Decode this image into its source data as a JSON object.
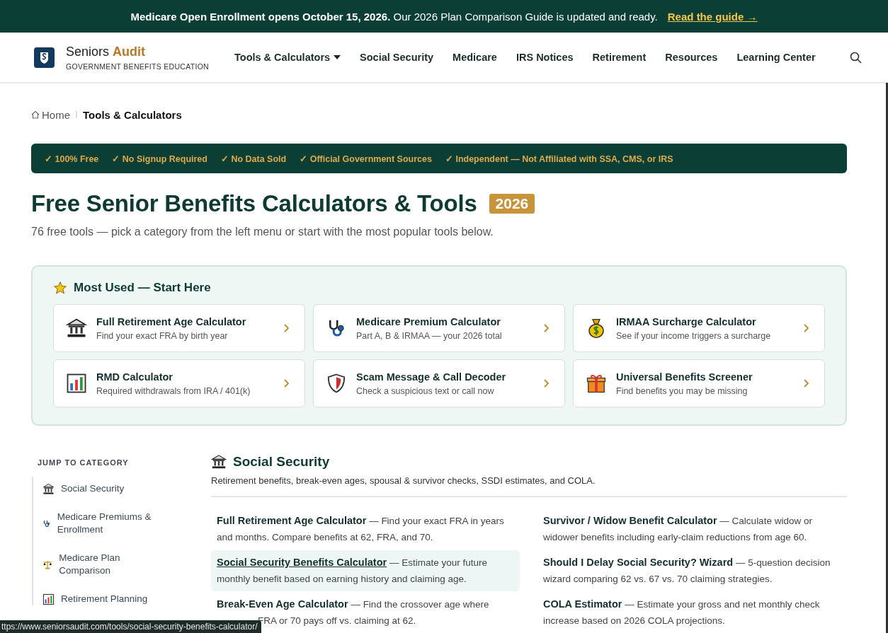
{
  "announcement": {
    "bold": "Medicare Open Enrollment opens October 15, 2026.",
    "text": "Our 2026 Plan Comparison Guide is updated and ready.",
    "link": "Read the guide →"
  },
  "header": {
    "brand_first": "Seniors",
    "brand_second": "Audit",
    "tagline": "GOVERNMENT BENEFITS EDUCATION",
    "nav": [
      {
        "label": "Tools & Calculators",
        "dropdown": true
      },
      {
        "label": "Social Security",
        "dropdown": false
      },
      {
        "label": "Medicare",
        "dropdown": false
      },
      {
        "label": "IRS Notices",
        "dropdown": false
      },
      {
        "label": "Retirement",
        "dropdown": false
      },
      {
        "label": "Resources",
        "dropdown": false
      },
      {
        "label": "Learning Center",
        "dropdown": false
      }
    ]
  },
  "breadcrumb": [
    {
      "label": "Home",
      "current": false
    },
    {
      "label": "Tools & Calculators",
      "current": true
    }
  ],
  "trust_badges": [
    "✓ 100% Free",
    "✓ No Signup Required",
    "✓ No Data Sold",
    "✓ Official Government Sources",
    "✓ Independent — Not Affiliated with SSA, CMS, or IRS"
  ],
  "page_title": "Free Senior Benefits Calculators & Tools",
  "year_badge": "2026",
  "intro": "76 free tools — pick a category from the left menu or start with the most popular tools below.",
  "most_used": {
    "title": "Most Used — Start Here",
    "cards": [
      {
        "title": "Full Retirement Age Calculator",
        "subtitle": "Find your exact FRA by birth year"
      },
      {
        "title": "Medicare Premium Calculator",
        "subtitle": "Part A, B & IRMAA — your 2026 total"
      },
      {
        "title": "IRMAA Surcharge Calculator",
        "subtitle": "See if your income triggers a surcharge"
      },
      {
        "title": "RMD Calculator",
        "subtitle": "Required withdrawals from IRA / 401(k)"
      },
      {
        "title": "Scam Message & Call Decoder",
        "subtitle": "Check a suspicious text or call now"
      },
      {
        "title": "Universal Benefits Screener",
        "subtitle": "Find benefits you may be missing"
      }
    ]
  },
  "sidebar": {
    "heading": "JUMP TO CATEGORY",
    "items": [
      {
        "label": "Social Security"
      },
      {
        "label": "Medicare Premiums & Enrollment"
      },
      {
        "label": "Medicare Plan Comparison"
      },
      {
        "label": "Retirement Planning"
      }
    ]
  },
  "section": {
    "title": "Social Security",
    "description": "Retirement benefits, break-even ages, spousal & survivor checks, SSDI estimates, and COLA.",
    "tools": [
      {
        "name": "Full Retirement Age Calculator",
        "description": "— Find your exact FRA in years and months. Compare benefits at 62, FRA, and 70.",
        "highlighted": false
      },
      {
        "name": "Survivor / Widow Benefit Calculator",
        "description": "— Calculate widow or widower benefits including early-claim reductions from age 60.",
        "highlighted": false
      },
      {
        "name": "Social Security Benefits Calculator",
        "description": "— Estimate your future monthly benefit based on earning history and claiming age.",
        "highlighted": true
      },
      {
        "name": "Should I Delay Social Security? Wizard",
        "description": "— 5-question decision wizard comparing 62 vs. 67 vs. 70 claiming strategies.",
        "highlighted": false
      },
      {
        "name": "Break-Even Age Calculator",
        "description": "— Find the crossover age where",
        "continued": "FRA or 70 pays off vs. claiming at 62.",
        "highlighted": false
      },
      {
        "name": "COLA Estimator",
        "description": "— Estimate your gross and net monthly check increase based on 2026 COLA projections.",
        "highlighted": false
      }
    ]
  },
  "status_bar": {
    "url": "ttps://www.seniorsaudit.com/tools/social-security-benefits-calculator/"
  }
}
